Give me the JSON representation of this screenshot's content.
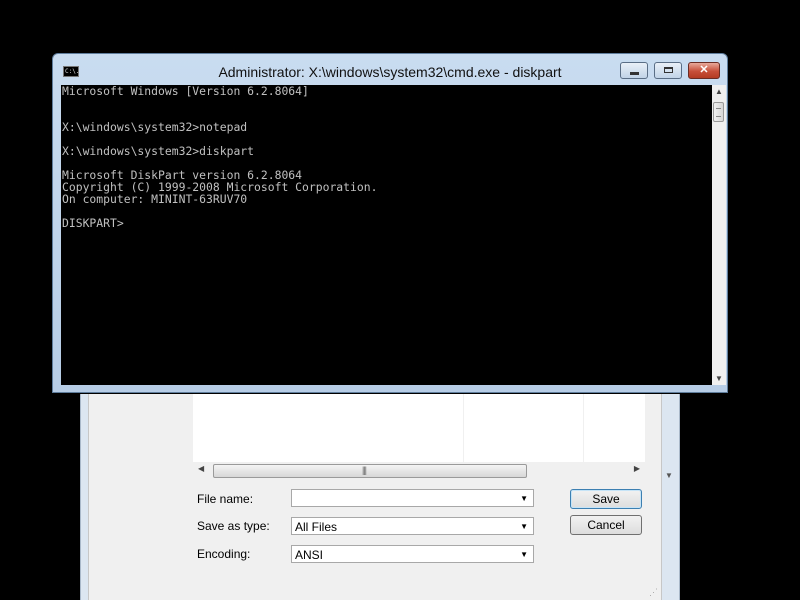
{
  "cmd_window": {
    "title": "Administrator: X:\\windows\\system32\\cmd.exe - diskpart",
    "icon_name": "cmd-console-icon",
    "icon_glyph": "C:\\.",
    "controls": {
      "minimize": "",
      "maximize": "",
      "close": "✕"
    },
    "console_lines": [
      "Microsoft Windows [Version 6.2.8064]",
      "",
      "",
      "X:\\windows\\system32>notepad",
      "",
      "X:\\windows\\system32>diskpart",
      "",
      "Microsoft DiskPart version 6.2.8064",
      "Copyright (C) 1999-2008 Microsoft Corporation.",
      "On computer: MININT-63RUV70",
      "",
      "DISKPART>"
    ]
  },
  "save_dialog": {
    "file_name_label": "File name:",
    "file_name_value": "",
    "save_as_type_label": "Save as type:",
    "save_as_type_value": "All Files",
    "encoding_label": "Encoding:",
    "encoding_value": "ANSI",
    "save_button": "Save",
    "cancel_button": "Cancel",
    "hscroll_grip": "|||"
  },
  "colors": {
    "desktop": "#000000",
    "console_bg": "#000000",
    "console_text": "#c0c0c0",
    "window_frame": "#c9dcf0",
    "close_button": "#c74f39",
    "dialog_bg": "#f0f0f0"
  }
}
